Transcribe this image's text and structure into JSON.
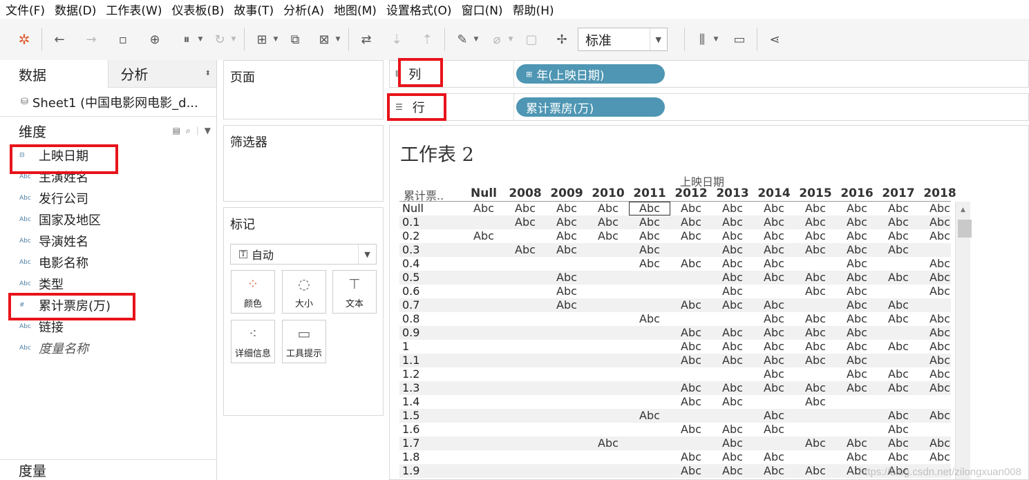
{
  "menu": [
    "文件(F)",
    "数据(D)",
    "工作表(W)",
    "仪表板(B)",
    "故事(T)",
    "分析(A)",
    "地图(M)",
    "设置格式(O)",
    "窗口(N)",
    "帮助(H)"
  ],
  "toolbar": {
    "icons": [
      "tableau-logo-icon",
      "back-icon",
      "forward-icon",
      "save-icon",
      "new-datasource-icon",
      "pause-icon",
      "refresh-icon",
      "new-sheet-icon",
      "duplicate-sheet-icon",
      "clear-sheet-icon",
      "swap-icon",
      "sort-asc-icon",
      "sort-desc-icon",
      "highlight-icon",
      "group-icon",
      "label-icon",
      "pin-icon",
      "show-me-icon",
      "presentation-icon",
      "share-icon"
    ],
    "fit_select": "标准"
  },
  "left_pane": {
    "tab_data": "数据",
    "tab_analysis": "分析",
    "datasource": "Sheet1 (中国电影网电影_d...",
    "dimensions_header": "维度",
    "dimensions": [
      {
        "icon": "date-icon",
        "type_glyph": "⊟",
        "label": "上映日期"
      },
      {
        "icon": "string-icon",
        "type_glyph": "Abc",
        "label": "主演姓名"
      },
      {
        "icon": "string-icon",
        "type_glyph": "Abc",
        "label": "发行公司"
      },
      {
        "icon": "string-icon",
        "type_glyph": "Abc",
        "label": "国家及地区"
      },
      {
        "icon": "string-icon",
        "type_glyph": "Abc",
        "label": "导演姓名"
      },
      {
        "icon": "string-icon",
        "type_glyph": "Abc",
        "label": "电影名称"
      },
      {
        "icon": "string-icon",
        "type_glyph": "Abc",
        "label": "类型"
      },
      {
        "icon": "number-icon",
        "type_glyph": "#",
        "label": "累计票房(万)"
      },
      {
        "icon": "string-icon",
        "type_glyph": "Abc",
        "label": "链接"
      },
      {
        "icon": "string-icon",
        "type_glyph": "Abc",
        "label": "度量名称"
      }
    ],
    "measures_header": "度量"
  },
  "cards": {
    "pages": "页面",
    "filters": "筛选器",
    "marks": "标记",
    "marks_type": "自动",
    "mark_buttons": [
      "颜色",
      "大小",
      "文本",
      "详细信息",
      "工具提示"
    ]
  },
  "shelves": {
    "columns_label": "列",
    "columns_pill": "年(上映日期)",
    "rows_label": "行",
    "rows_pill": "累计票房(万)"
  },
  "view": {
    "title": "工作表 2",
    "column_field": "上映日期",
    "row_header": "累计票..",
    "years": [
      "Null",
      "2008",
      "2009",
      "2010",
      "2011",
      "2012",
      "2013",
      "2014",
      "2015",
      "2016",
      "2017",
      "2018"
    ],
    "cell_text": "Abc",
    "rows": [
      {
        "label": "Null",
        "cells": [
          1,
          1,
          1,
          1,
          1,
          1,
          1,
          1,
          1,
          1,
          1,
          1
        ]
      },
      {
        "label": "0.1",
        "cells": [
          0,
          1,
          1,
          1,
          1,
          1,
          1,
          1,
          1,
          1,
          1,
          1
        ]
      },
      {
        "label": "0.2",
        "cells": [
          1,
          0,
          1,
          1,
          1,
          1,
          1,
          1,
          1,
          1,
          1,
          1
        ]
      },
      {
        "label": "0.3",
        "cells": [
          0,
          1,
          1,
          0,
          1,
          0,
          1,
          1,
          1,
          1,
          1,
          0
        ]
      },
      {
        "label": "0.4",
        "cells": [
          0,
          0,
          0,
          0,
          1,
          1,
          1,
          1,
          0,
          1,
          0,
          1
        ]
      },
      {
        "label": "0.5",
        "cells": [
          0,
          0,
          1,
          0,
          0,
          0,
          1,
          1,
          1,
          1,
          1,
          1
        ]
      },
      {
        "label": "0.6",
        "cells": [
          0,
          0,
          1,
          0,
          0,
          0,
          1,
          0,
          1,
          1,
          0,
          1
        ]
      },
      {
        "label": "0.7",
        "cells": [
          0,
          0,
          1,
          0,
          0,
          1,
          1,
          1,
          0,
          1,
          1,
          0
        ]
      },
      {
        "label": "0.8",
        "cells": [
          0,
          0,
          0,
          0,
          1,
          0,
          0,
          1,
          1,
          1,
          1,
          1
        ]
      },
      {
        "label": "0.9",
        "cells": [
          0,
          0,
          0,
          0,
          0,
          1,
          1,
          1,
          1,
          1,
          0,
          1
        ]
      },
      {
        "label": "1",
        "cells": [
          0,
          0,
          0,
          0,
          0,
          1,
          1,
          1,
          1,
          1,
          1,
          1
        ]
      },
      {
        "label": "1.1",
        "cells": [
          0,
          0,
          0,
          0,
          0,
          1,
          1,
          1,
          1,
          1,
          0,
          1
        ]
      },
      {
        "label": "1.2",
        "cells": [
          0,
          0,
          0,
          0,
          0,
          0,
          0,
          1,
          0,
          1,
          1,
          1
        ]
      },
      {
        "label": "1.3",
        "cells": [
          0,
          0,
          0,
          0,
          0,
          1,
          1,
          1,
          1,
          1,
          1,
          1
        ]
      },
      {
        "label": "1.4",
        "cells": [
          0,
          0,
          0,
          0,
          0,
          1,
          1,
          0,
          1,
          0,
          0,
          0
        ]
      },
      {
        "label": "1.5",
        "cells": [
          0,
          0,
          0,
          0,
          1,
          0,
          0,
          1,
          0,
          0,
          1,
          1
        ]
      },
      {
        "label": "1.6",
        "cells": [
          0,
          0,
          0,
          0,
          0,
          1,
          1,
          1,
          0,
          0,
          1,
          0
        ]
      },
      {
        "label": "1.7",
        "cells": [
          0,
          0,
          0,
          1,
          0,
          0,
          1,
          0,
          1,
          1,
          1,
          1
        ]
      },
      {
        "label": "1.8",
        "cells": [
          0,
          0,
          0,
          0,
          0,
          1,
          1,
          1,
          0,
          1,
          1,
          1
        ]
      },
      {
        "label": "1.9",
        "cells": [
          0,
          0,
          0,
          0,
          0,
          1,
          1,
          1,
          1,
          1,
          1,
          0
        ]
      }
    ]
  },
  "watermark": "https://blog.csdn.net/zilongxuan008",
  "colors": {
    "pill": "#4e96b3",
    "highlight": "#e8131b"
  }
}
